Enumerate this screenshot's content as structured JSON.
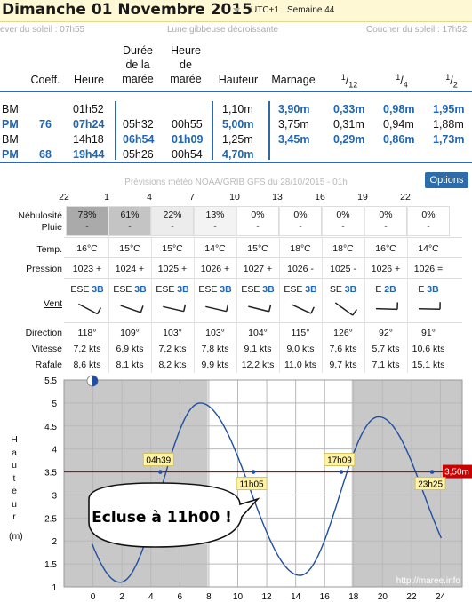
{
  "header": {
    "date_title": "Dimanche 01 Novembre 2015",
    "timezone": "UTC+1",
    "week": "Semaine 44"
  },
  "sun_moon": {
    "sunrise": "ever du soleil : 07h55",
    "moon": "Lune gibbeuse décroissante",
    "sunset": "Coucher du soleil : 17h52"
  },
  "tide_table": {
    "headers": {
      "coeff": "Coeff.",
      "heure": "Heure",
      "duree_l1": "Durée",
      "duree_l2": "de la",
      "duree_l3": "marée",
      "heure_maree_l1": "Heure",
      "heure_maree_l2": "de",
      "heure_maree_l3": "marée",
      "hauteur": "Hauteur",
      "marnage": "Marnage",
      "twelfth": "12",
      "quarter": "4",
      "half": "2"
    },
    "rows": [
      {
        "type": "BM",
        "coeff": "",
        "heure": "01h52",
        "duree": "",
        "heure_maree": "",
        "hauteur": "1,10m",
        "marnage": "3,90m",
        "twelfth": "0,33m",
        "quarter": "0,98m",
        "half": "1,95m"
      },
      {
        "type": "PM",
        "coeff": "76",
        "heure": "07h24",
        "duree": "05h32",
        "heure_maree": "00h55",
        "hauteur": "5,00m",
        "marnage": "3,75m",
        "twelfth": "0,31m",
        "quarter": "0,94m",
        "half": "1,88m"
      },
      {
        "type": "BM",
        "coeff": "",
        "heure": "14h18",
        "duree": "06h54",
        "heure_maree": "01h09",
        "hauteur": "1,25m",
        "marnage": "3,45m",
        "twelfth": "0,29m",
        "quarter": "0,86m",
        "half": "1,73m"
      },
      {
        "type": "PM",
        "coeff": "68",
        "heure": "19h44",
        "duree": "05h26",
        "heure_maree": "00h54",
        "hauteur": "4,70m",
        "marnage": "",
        "twelfth": "",
        "quarter": "",
        "half": ""
      }
    ]
  },
  "forecast": {
    "title": "Prévisions météo NOAA/GRIB GFS du 28/10/2015 - 01h",
    "options_label": "Options",
    "hours": [
      "22",
      "1",
      "4",
      "7",
      "10",
      "13",
      "16",
      "19",
      "22"
    ],
    "labels": {
      "nebulosite": "Nébulosité",
      "pluie": "Pluie",
      "temp": "Temp.",
      "pression": "Pression",
      "vent": "Vent",
      "direction": "Direction",
      "vitesse": "Vitesse",
      "rafale": "Rafale"
    },
    "columns": [
      {
        "neb": "78%",
        "pluie": "-",
        "temp": "16°C",
        "pression": "1023 +",
        "wind_dir": "ESE",
        "wind_force": "3B",
        "direction": "118°",
        "vitesse": "7,2 kts",
        "rafale": "8,6 kts",
        "shade": "#aaaaaa"
      },
      {
        "neb": "61%",
        "pluie": "-",
        "temp": "15°C",
        "pression": "1024 +",
        "wind_dir": "ESE",
        "wind_force": "3B",
        "direction": "109°",
        "vitesse": "6,9 kts",
        "rafale": "8,1 kts",
        "shade": "#c4c4c4"
      },
      {
        "neb": "22%",
        "pluie": "-",
        "temp": "15°C",
        "pression": "1025 +",
        "wind_dir": "ESE",
        "wind_force": "3B",
        "direction": "103°",
        "vitesse": "7,2 kts",
        "rafale": "8,2 kts",
        "shade": "#ececec"
      },
      {
        "neb": "13%",
        "pluie": "-",
        "temp": "14°C",
        "pression": "1026 +",
        "wind_dir": "ESE",
        "wind_force": "3B",
        "direction": "103°",
        "vitesse": "7,8 kts",
        "rafale": "9,9 kts",
        "shade": "#f3f3f3"
      },
      {
        "neb": "0%",
        "pluie": "-",
        "temp": "15°C",
        "pression": "1027 +",
        "wind_dir": "ESE",
        "wind_force": "3B",
        "direction": "104°",
        "vitesse": "9,1 kts",
        "rafale": "12,2 kts",
        "shade": "#ffffff"
      },
      {
        "neb": "0%",
        "pluie": "-",
        "temp": "18°C",
        "pression": "1026 -",
        "wind_dir": "ESE",
        "wind_force": "3B",
        "direction": "115°",
        "vitesse": "9,0 kts",
        "rafale": "11,0 kts",
        "shade": "#ffffff"
      },
      {
        "neb": "0%",
        "pluie": "-",
        "temp": "18°C",
        "pression": "1025 -",
        "wind_dir": "SE",
        "wind_force": "3B",
        "direction": "126°",
        "vitesse": "7,6 kts",
        "rafale": "9,7 kts",
        "shade": "#ffffff"
      },
      {
        "neb": "0%",
        "pluie": "-",
        "temp": "16°C",
        "pression": "1026 +",
        "wind_dir": "E",
        "wind_force": "2B",
        "direction": "92°",
        "vitesse": "5,7 kts",
        "rafale": "7,1 kts",
        "shade": "#ffffff"
      },
      {
        "neb": "0%",
        "pluie": "-",
        "temp": "14°C",
        "pression": "1026 =",
        "wind_dir": "E",
        "wind_force": "3B",
        "direction": "91°",
        "vitesse": "10,6 kts",
        "rafale": "15,1 kts",
        "shade": "#ffffff"
      }
    ]
  },
  "chart_data": {
    "type": "line",
    "ylabel": "Hauteur (m)",
    "ylim": [
      1,
      5.5
    ],
    "xlim": [
      -2,
      25.5
    ],
    "xticks": [
      0,
      2,
      4,
      6,
      8,
      10,
      12,
      14,
      16,
      18,
      20,
      22,
      24
    ],
    "yticks": [
      1,
      1.5,
      2,
      2.5,
      3,
      3.5,
      4,
      4.5,
      5,
      5.5
    ],
    "night_before": 7.92,
    "night_after": 17.87,
    "threshold": 3.5,
    "threshold_label": "3,50m",
    "threshold_color": "#cc0000",
    "tide_points": [
      {
        "x": 1.87,
        "y": 1.1
      },
      {
        "x": 7.4,
        "y": 5.0
      },
      {
        "x": 14.3,
        "y": 1.25
      },
      {
        "x": 19.73,
        "y": 4.7
      }
    ],
    "crossings": [
      {
        "x": 4.65,
        "label": "04h39"
      },
      {
        "x": 11.08,
        "label": "11h05"
      },
      {
        "x": 17.15,
        "label": "17h09"
      },
      {
        "x": 23.42,
        "label": "23h25"
      }
    ],
    "callout": "Ecluse à 11h00 !",
    "watermark": "http://maree.info"
  }
}
